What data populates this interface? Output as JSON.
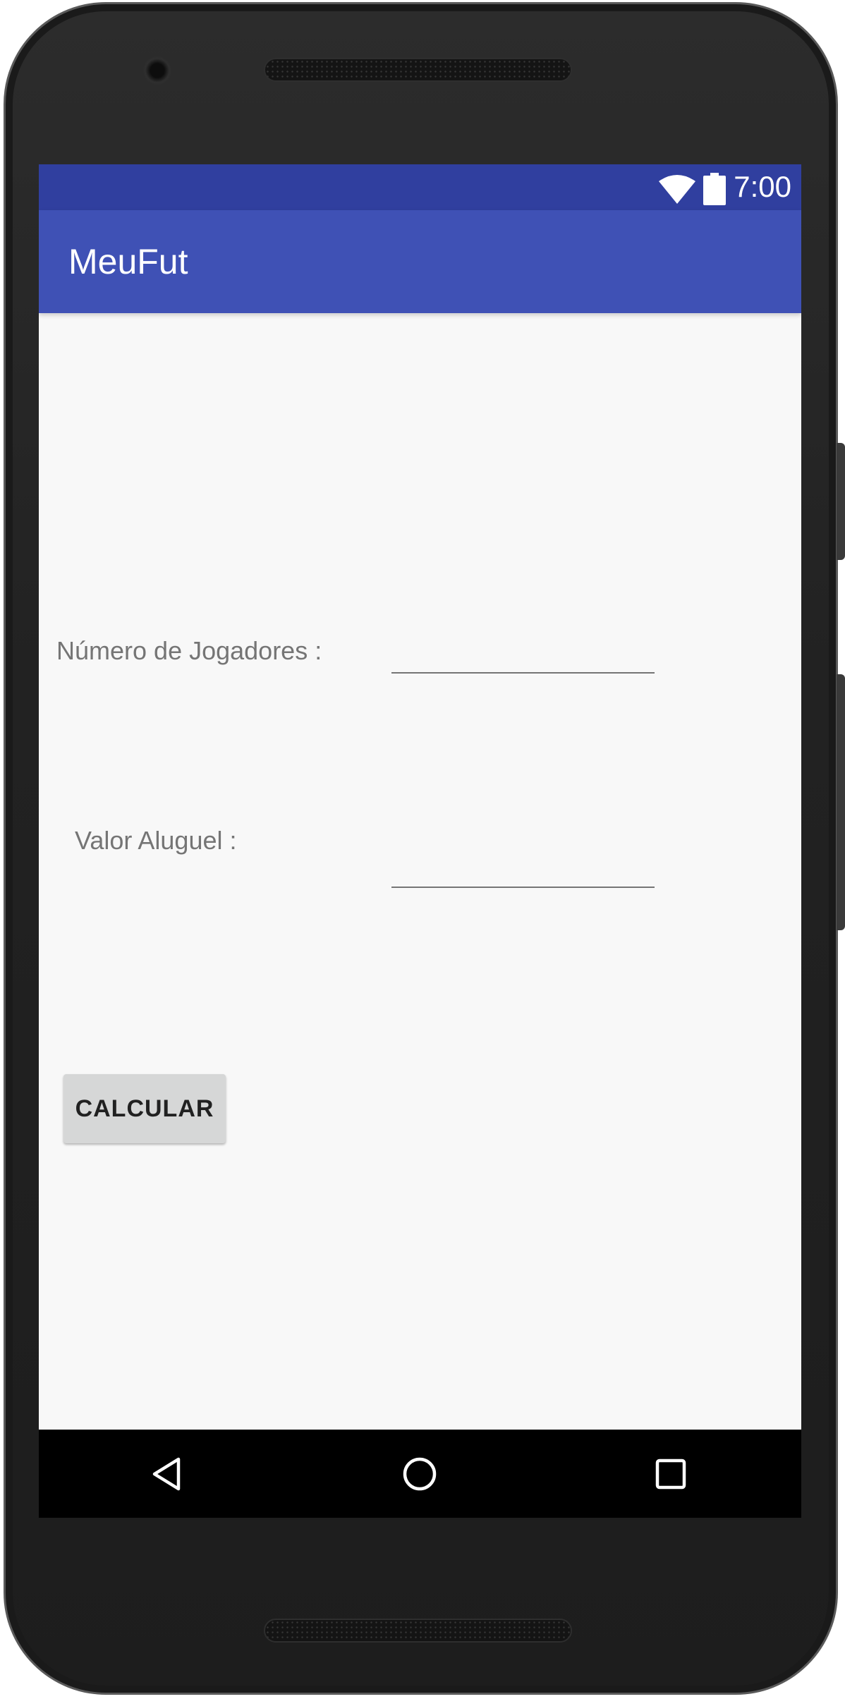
{
  "status_bar": {
    "time": "7:00",
    "icons": [
      "wifi-icon",
      "battery-icon"
    ],
    "color": "#303f9f"
  },
  "app_bar": {
    "title": "MeuFut",
    "color": "#3f51b5"
  },
  "form": {
    "players_label": "Número de Jogadores :",
    "players_value": "",
    "rent_label": "Valor Aluguel :",
    "rent_value": "",
    "calculate_label": "CALCULAR"
  },
  "nav_bar": {
    "icons": [
      "back-icon",
      "home-icon",
      "recent-apps-icon"
    ]
  }
}
